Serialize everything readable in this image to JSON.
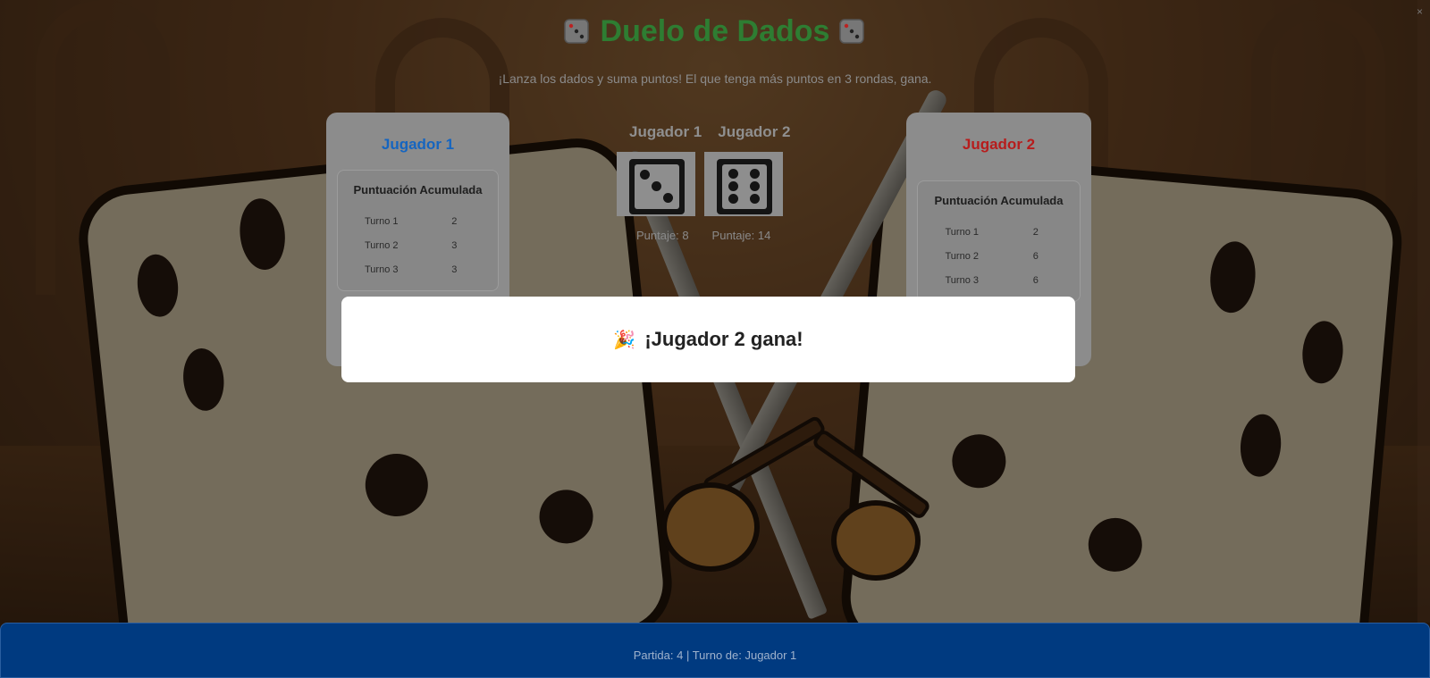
{
  "header": {
    "title": "Duelo de Dados",
    "subtitle": "¡Lanza los dados y suma puntos! El que tenga más puntos en 3 rondas, gana."
  },
  "players": [
    {
      "name": "Jugador 1",
      "score_title": "Puntuación Acumulada",
      "turns": [
        {
          "label": "Turno 1",
          "value": "2"
        },
        {
          "label": "Turno 2",
          "value": "3"
        },
        {
          "label": "Turno 3",
          "value": "3"
        }
      ]
    },
    {
      "name": "Jugador 2",
      "score_title": "Puntuación Acumulada",
      "turns": [
        {
          "label": "Turno 1",
          "value": "2"
        },
        {
          "label": "Turno 2",
          "value": "6"
        },
        {
          "label": "Turno 3",
          "value": "6"
        }
      ]
    }
  ],
  "dice": {
    "label_p1": "Jugador 1",
    "label_p2": "Jugador 2",
    "face_p1": 3,
    "face_p2": 6,
    "score_p1": "Puntaje: 8",
    "score_p2": "Puntaje: 14"
  },
  "winner": {
    "icon": "party-popper-icon",
    "glyph": "🎉",
    "text": "¡Jugador 2 gana!"
  },
  "footer": {
    "status": "Partida: 4 | Turno de: Jugador 1"
  },
  "colors": {
    "title": "#2e7d32",
    "player1": "#1565c0",
    "player2": "#b71c1c",
    "footer": "#003a80"
  }
}
